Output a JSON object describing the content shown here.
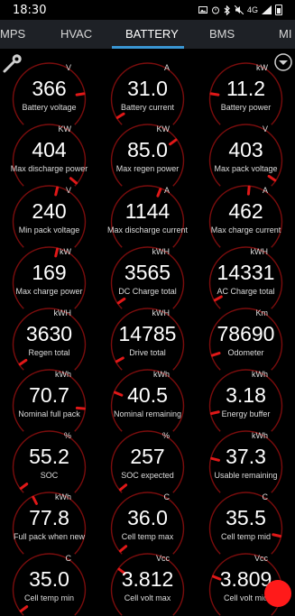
{
  "status_bar": {
    "time": "18:30",
    "network": "4G"
  },
  "tabs": [
    {
      "label": "MPS",
      "active": false
    },
    {
      "label": "HVAC",
      "active": false
    },
    {
      "label": "BATTERY",
      "active": true
    },
    {
      "label": "BMS",
      "active": false
    },
    {
      "label": "MI",
      "active": false
    }
  ],
  "colors": {
    "accent": "#3a97d4",
    "gauge_red": "#e01818",
    "fab": "#ff1a1a"
  },
  "icons": {
    "left": "wrench-icon",
    "right": "dropdown-menu-icon"
  },
  "gauges": [
    {
      "label": "Battery voltage",
      "value": "366",
      "unit": "V",
      "level": 0.8
    },
    {
      "label": "Battery current",
      "value": "31.0",
      "unit": "A",
      "level": 0.05
    },
    {
      "label": "Battery power",
      "value": "11.2",
      "unit": "kW",
      "level": 0.2
    },
    {
      "label": "Max discharge power",
      "value": "404",
      "unit": "KW",
      "level": 0.98
    },
    {
      "label": "Max regen power",
      "value": "85.0",
      "unit": "KW",
      "level": 0.7
    },
    {
      "label": "Max pack voltage",
      "value": "403",
      "unit": "V",
      "level": 0.96
    },
    {
      "label": "Min pack voltage",
      "value": "240",
      "unit": "V",
      "level": 0.55
    },
    {
      "label": "Max discharge current",
      "value": "1144",
      "unit": "A",
      "level": 0.58
    },
    {
      "label": "Max charge current",
      "value": "462",
      "unit": "A",
      "level": 0.52
    },
    {
      "label": "Max charge power",
      "value": "169",
      "unit": "kW",
      "level": 0.55
    },
    {
      "label": "DC Charge total",
      "value": "3565",
      "unit": "kWH",
      "level": 0.04
    },
    {
      "label": "AC Charge total",
      "value": "14331",
      "unit": "kWH",
      "level": 0.06
    },
    {
      "label": "Regen total",
      "value": "3630",
      "unit": "kWH",
      "level": 0.04
    },
    {
      "label": "Drive total",
      "value": "14785",
      "unit": "kWH",
      "level": 0.06
    },
    {
      "label": "Odometer",
      "value": "78690",
      "unit": "Km",
      "level": 0.1
    },
    {
      "label": "Nominal full pack",
      "value": "70.7",
      "unit": "kWh",
      "level": 0.85
    },
    {
      "label": "Nominal remaining",
      "value": "40.5",
      "unit": "kWh",
      "level": 0.25
    },
    {
      "label": "Energy buffer",
      "value": "3.18",
      "unit": "kWh",
      "level": 0.12
    },
    {
      "label": "SOC",
      "value": "55.2",
      "unit": "%",
      "level": 0.03
    },
    {
      "label": "SOC expected",
      "value": "257",
      "unit": "%",
      "level": 0.02
    },
    {
      "label": "Usable remaining",
      "value": "37.3",
      "unit": "kWh",
      "level": 0.22
    },
    {
      "label": "Full pack when new",
      "value": "77.8",
      "unit": "kWh",
      "level": 0.4
    },
    {
      "label": "Cell temp max",
      "value": "36.0",
      "unit": "C",
      "level": 0.02
    },
    {
      "label": "Cell temp mid",
      "value": "35.5",
      "unit": "C",
      "level": 0.88
    },
    {
      "label": "Cell temp min",
      "value": "35.0",
      "unit": "C",
      "level": 0.03
    },
    {
      "label": "Cell volt max",
      "value": "3.812",
      "unit": "Vcc",
      "level": 0.3
    },
    {
      "label": "Cell volt mid",
      "value": "3.809",
      "unit": "Vcc",
      "level": 0.25
    }
  ]
}
